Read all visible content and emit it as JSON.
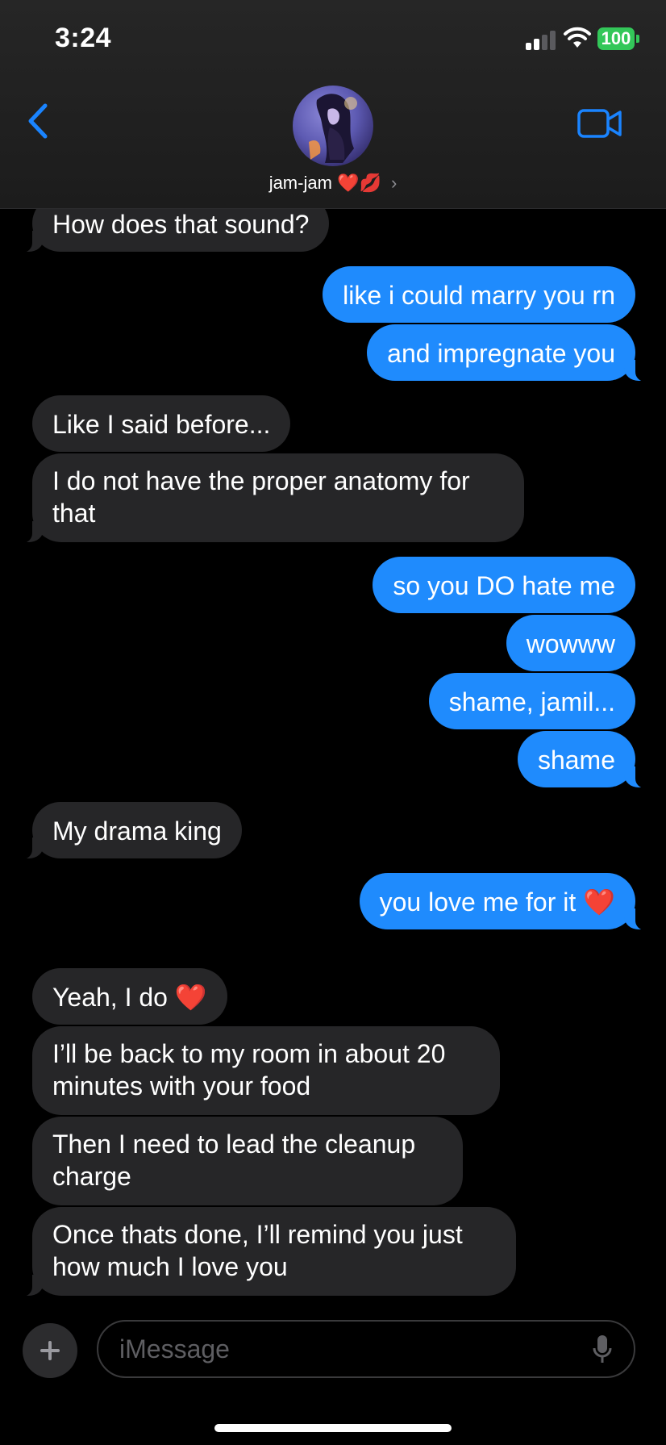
{
  "status_bar": {
    "time": "3:24",
    "battery": "100"
  },
  "contact": {
    "name": "jam-jam",
    "emoji": "❤️💋",
    "chevron": "›"
  },
  "messages": [
    {
      "from": "them",
      "text": "How does that sound?"
    },
    {
      "from": "me",
      "text": "like i could marry you rn"
    },
    {
      "from": "me",
      "text": "and impregnate you"
    },
    {
      "from": "them",
      "text": "Like I said before..."
    },
    {
      "from": "them",
      "text": "I do not have the proper anatomy for that"
    },
    {
      "from": "me",
      "text": "so you DO hate me"
    },
    {
      "from": "me",
      "text": "wowww"
    },
    {
      "from": "me",
      "text": "shame, jamil..."
    },
    {
      "from": "me",
      "text": "shame"
    },
    {
      "from": "them",
      "text": "My drama king"
    },
    {
      "from": "me",
      "text": "you love me for it",
      "emoji": "❤️"
    },
    {
      "from": "them",
      "text": "Yeah, I do",
      "emoji": "❤️"
    },
    {
      "from": "them",
      "text": "I’ll be back to my room in about 20 minutes with your food"
    },
    {
      "from": "them",
      "text": "Then I need to lead the cleanup charge"
    },
    {
      "from": "them",
      "text": "Once thats done, I’ll remind you just how much I love you"
    }
  ],
  "composer": {
    "placeholder": "iMessage"
  },
  "colors": {
    "outgoing": "#1f8bfd",
    "incoming": "#262628",
    "accent": "#1a84ff",
    "battery": "#33c759"
  }
}
